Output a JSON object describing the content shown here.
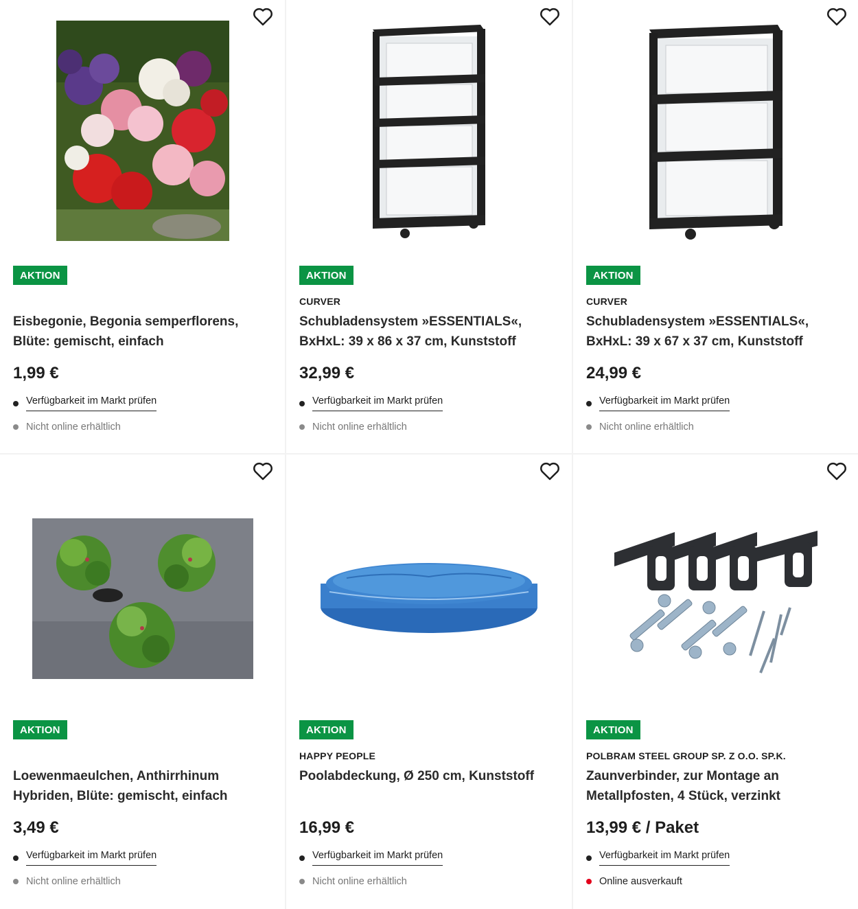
{
  "accent_color": "#0b9444",
  "products": [
    {
      "badge": "AKTION",
      "brand": "",
      "title": "Eisbegonie, Begonia semperflorens, Blüte: gemischt, einfach",
      "price": "1,99 €",
      "availability_link": "Verfügbarkeit im Markt prüfen",
      "online_status": "Nicht online erhältlich",
      "favorite_icon": "heart-outline-icon"
    },
    {
      "badge": "AKTION",
      "brand": "CURVER",
      "title": "Schubladensystem »ESSENTIALS«, BxHxL: 39 x 86 x 37 cm, Kunststoff",
      "price": "32,99 €",
      "availability_link": "Verfügbarkeit im Markt prüfen",
      "online_status": "Nicht online erhältlich",
      "favorite_icon": "heart-outline-icon"
    },
    {
      "badge": "AKTION",
      "brand": "CURVER",
      "title": "Schubladensystem »ESSENTIALS«, BxHxL: 39 x 67 x 37 cm, Kunststoff",
      "price": "24,99 €",
      "availability_link": "Verfügbarkeit im Markt prüfen",
      "online_status": "Nicht online erhältlich",
      "favorite_icon": "heart-outline-icon"
    },
    {
      "badge": "AKTION",
      "brand": "",
      "title": "Loewenmaeulchen, Anthirrhinum Hybriden, Blüte: gemischt, einfach",
      "price": "3,49 €",
      "availability_link": "Verfügbarkeit im Markt prüfen",
      "online_status": "Nicht online erhältlich",
      "favorite_icon": "heart-outline-icon"
    },
    {
      "badge": "AKTION",
      "brand": "HAPPY PEOPLE",
      "title": "Poolabdeckung, Ø 250 cm, Kunststoff",
      "price": "16,99 €",
      "availability_link": "Verfügbarkeit im Markt prüfen",
      "online_status": "Nicht online erhältlich",
      "favorite_icon": "heart-outline-icon"
    },
    {
      "badge": "AKTION",
      "brand": "POLBRAM STEEL GROUP SP. Z O.O. SP.K.",
      "title": "Zaunverbinder, zur Montage an Metallpfosten, 4 Stück, verzinkt",
      "price": "13,99 € / Paket",
      "availability_link": "Verfügbarkeit im Markt prüfen",
      "online_status": "Online ausverkauft",
      "favorite_icon": "heart-outline-icon"
    }
  ]
}
